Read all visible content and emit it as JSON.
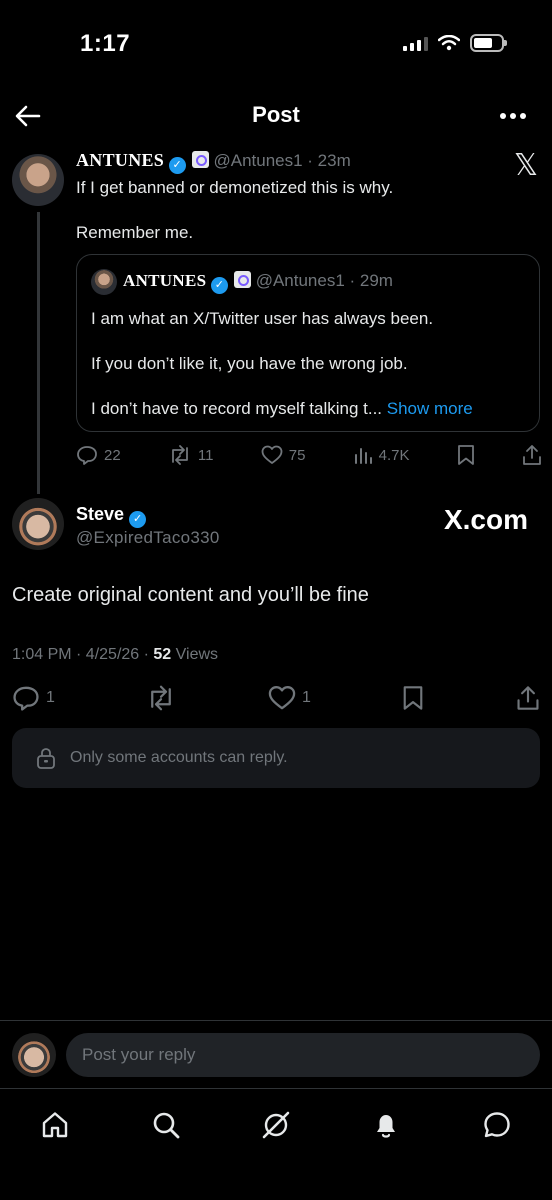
{
  "status_bar": {
    "time": "1:17"
  },
  "header": {
    "title": "Post"
  },
  "parent_post": {
    "author_name": "ANTUNES",
    "handle_time": "@Antunes1 · 23m",
    "text_line1": "If I get banned or demonetized this is why.",
    "text_line2": "Remember me.",
    "quote": {
      "author_name": "ANTUNES",
      "handle_time": "@Antunes1 · 29m",
      "line1": "I am what an X/Twitter user has always been.",
      "line2": "If you don’t like it, you have the wrong job.",
      "line3": "I don’t have to record myself talking t...",
      "show_more": "Show more"
    },
    "actions": {
      "replies": "22",
      "reposts": "11",
      "likes": "75",
      "views": "4.7K"
    }
  },
  "main_post": {
    "author_name": "Steve",
    "handle": "@ExpiredTaco330",
    "watermark": "X.com",
    "text": "Create original content and you’ll be fine",
    "timestamp": "1:04 PM · 4/25/26 · ",
    "views_count": "52",
    "views_label": " Views",
    "actions": {
      "replies": "1",
      "likes": "1"
    },
    "restriction": "Only some accounts can reply."
  },
  "composer": {
    "placeholder": "Post your reply"
  },
  "icons": [
    "back-arrow-icon",
    "more-icon",
    "x-logo-icon",
    "verified-icon",
    "reply-icon",
    "repost-icon",
    "like-icon",
    "views-icon",
    "bookmark-icon",
    "share-icon",
    "lock-icon",
    "home-icon",
    "search-icon",
    "grok-icon",
    "notifications-icon",
    "messages-icon"
  ],
  "colors": {
    "background": "#000000",
    "accent": "#1d9bf0",
    "muted": "#71767b",
    "text": "#e7e9ea"
  }
}
